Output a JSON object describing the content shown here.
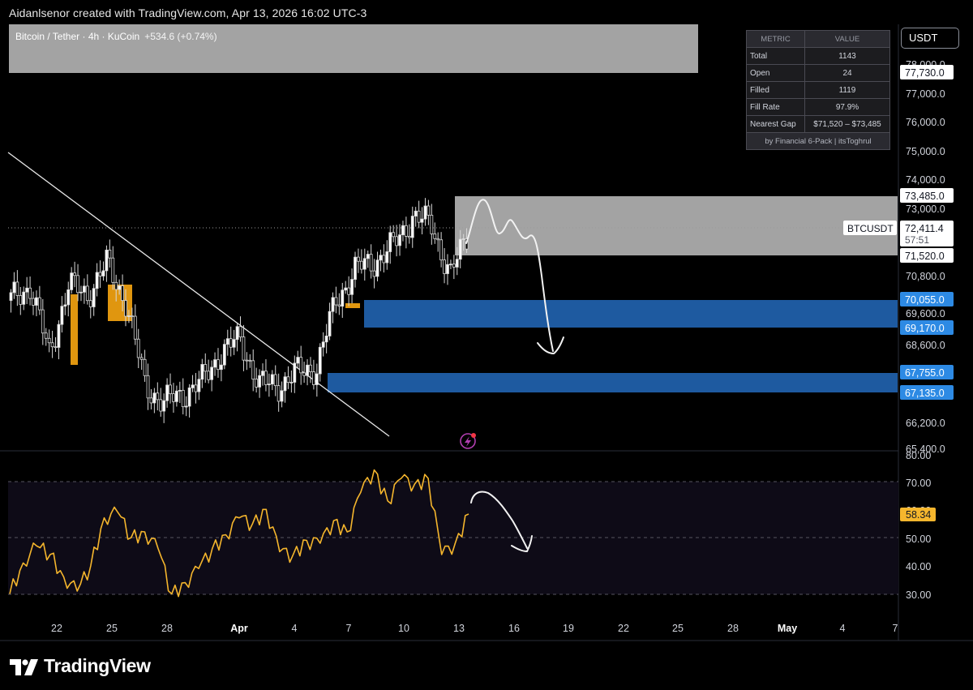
{
  "header": {
    "credit": "Aidanlsenor created with TradingView.com, Apr 13, 2026 16:02 UTC-3",
    "symbol": "Bitcoin / Tether · 4h · KuCoin",
    "change": "+534.6 (+0.74%)",
    "unit": "USDT"
  },
  "metrics_table": {
    "headers": [
      "METRIC",
      "VALUE"
    ],
    "rows": [
      {
        "metric": "Total",
        "value": "1143"
      },
      {
        "metric": "Open",
        "value": "24"
      },
      {
        "metric": "Filled",
        "value": "1119"
      },
      {
        "metric": "Fill Rate",
        "value": "97.9%"
      },
      {
        "metric": "Nearest Gap",
        "value": "$71,520 – $73,485"
      }
    ],
    "footer": "by Financial 6-Pack | itsToghrul"
  },
  "chart_data": [
    {
      "type": "candlestick",
      "name": "Bitcoin / Tether · 4h · KuCoin",
      "ylim": [
        65400,
        78800
      ],
      "y_ticks": [
        "78,000.0",
        "77,000.0",
        "76,000.0",
        "75,000.0",
        "74,000.0",
        "73,000.0",
        "70,800.0",
        "69,600.0",
        "68,600.0",
        "66,200.0",
        "65,400.0"
      ],
      "x_ticks": [
        "22",
        "25",
        "28",
        "Apr",
        "4",
        "7",
        "10",
        "13",
        "16",
        "19",
        "22",
        "25",
        "28",
        "May",
        "4",
        "7"
      ],
      "x": [
        "Mar 20",
        "Mar 21",
        "Mar 22",
        "Mar 23",
        "Mar 24",
        "Mar 25",
        "Mar 26",
        "Mar 27",
        "Mar 28",
        "Mar 29",
        "Mar 30",
        "Mar 31",
        "Apr 1",
        "Apr 2",
        "Apr 3",
        "Apr 4",
        "Apr 5",
        "Apr 6",
        "Apr 7",
        "Apr 8",
        "Apr 9",
        "Apr 10",
        "Apr 11",
        "Apr 12",
        "Apr 13"
      ],
      "close": [
        70000,
        70500,
        68200,
        70500,
        70200,
        71200,
        70000,
        67200,
        66600,
        66900,
        67300,
        68300,
        68700,
        67200,
        67200,
        67600,
        67800,
        70000,
        71000,
        71300,
        71800,
        72800,
        72500,
        70800,
        72411.4
      ],
      "price_labels": [
        {
          "label": "77,730.0",
          "value": 77730,
          "kind": "level"
        },
        {
          "label": "73,485.0",
          "value": 73485,
          "kind": "level"
        },
        {
          "label": "72,411.4",
          "value": 72411.4,
          "kind": "last",
          "symbol": "BTCUSDT",
          "countdown": "57:51"
        },
        {
          "label": "71,520.0",
          "value": 71520,
          "kind": "level"
        },
        {
          "label": "70,055.0",
          "value": 70055,
          "kind": "blue"
        },
        {
          "label": "69,170.0",
          "value": 69170,
          "kind": "blue"
        },
        {
          "label": "67,755.0",
          "value": 67755,
          "kind": "blue"
        },
        {
          "label": "67,135.0",
          "value": 67135,
          "kind": "blue"
        }
      ],
      "zones": [
        {
          "type": "gap",
          "from": 71520,
          "to": 73485,
          "color": "#a3a3a3"
        },
        {
          "type": "blue-zone",
          "from": 69170,
          "to": 70055,
          "color": "#1e5aa0"
        },
        {
          "type": "blue-zone",
          "from": 67135,
          "to": 67755,
          "color": "#1e5aa0"
        }
      ]
    },
    {
      "type": "line",
      "name": "RSI",
      "ylim": [
        25,
        80
      ],
      "y_ticks": [
        "80.00",
        "70.00",
        "60.00",
        "50.00",
        "40.00",
        "30.00"
      ],
      "current_value": "58.34",
      "values": [
        30,
        41,
        47,
        44,
        36,
        31,
        40,
        57,
        59,
        50,
        52,
        46,
        30,
        34,
        39,
        46,
        51,
        57,
        55,
        60,
        45,
        44,
        49,
        48,
        56,
        52,
        66,
        74,
        63,
        71,
        69,
        71,
        44,
        48,
        58.34
      ],
      "levels": [
        70,
        50,
        30
      ],
      "color": "#f5b62d"
    }
  ],
  "footer": {
    "brand": "TradingView"
  },
  "colors": {
    "background": "#000000",
    "gap_zone": "#a3a3a3",
    "blue_zone": "#1e5aa0",
    "order_block": "#e0960f",
    "rsi": "#f5b62d",
    "label_blue": "#2d8ae4"
  }
}
